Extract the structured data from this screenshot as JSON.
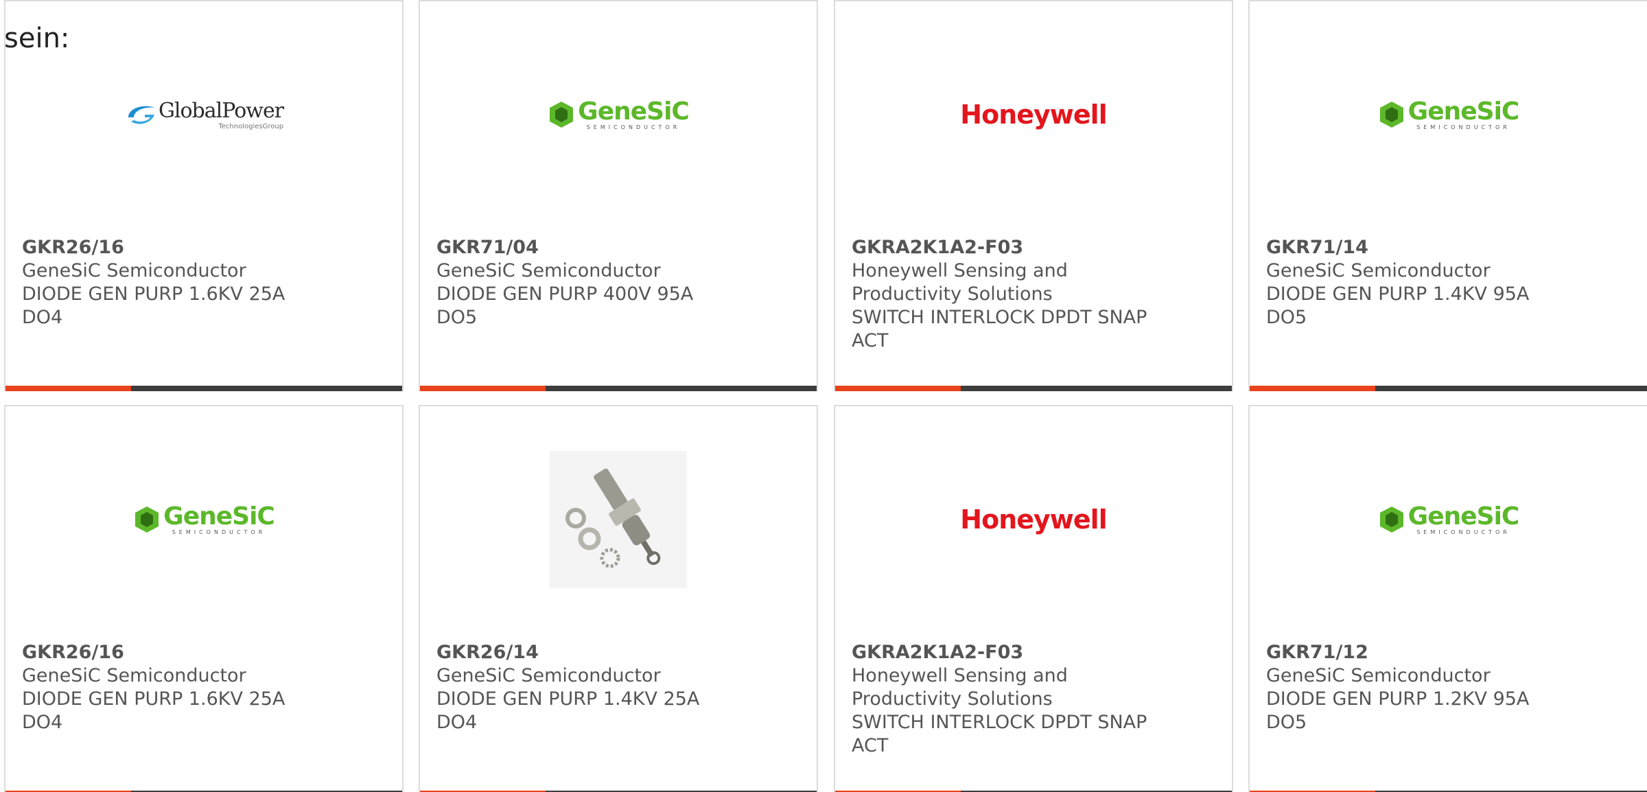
{
  "intro_text": "sein:",
  "colors": {
    "accent": "#e8431c",
    "bar": "#3d3d3d",
    "genesic_green": "#5cb82a",
    "honeywell_red": "#e3161d"
  },
  "products": [
    {
      "part": "GKR26/16",
      "manufacturer": "GeneSiC Semiconductor",
      "description": "DIODE GEN PURP 1.6KV 25A DO4",
      "logo": "globalpower-logo",
      "logo_text": "GlobalPower",
      "logo_sub": "TechnologiesGroup"
    },
    {
      "part": "GKR71/04",
      "manufacturer": "GeneSiC Semiconductor",
      "description": "DIODE GEN PURP 400V 95A DO5",
      "logo": "genesic-logo",
      "logo_text": "GeneSiC",
      "logo_sub": "SEMICONDUCTOR"
    },
    {
      "part": "GKRA2K1A2-F03",
      "manufacturer": "Honeywell Sensing and Productivity Solutions",
      "description": "SWITCH INTERLOCK DPDT SNAP ACT",
      "logo": "honeywell-logo",
      "logo_text": "Honeywell"
    },
    {
      "part": "GKR71/14",
      "manufacturer": "GeneSiC Semiconductor",
      "description": "DIODE GEN PURP 1.4KV 95A DO5",
      "logo": "genesic-logo",
      "logo_text": "GeneSiC",
      "logo_sub": "SEMICONDUCTOR"
    },
    {
      "part": "GKR26/16",
      "manufacturer": "GeneSiC Semiconductor",
      "description": "DIODE GEN PURP 1.6KV 25A DO4",
      "logo": "genesic-logo",
      "logo_text": "GeneSiC",
      "logo_sub": "SEMICONDUCTOR"
    },
    {
      "part": "GKR26/14",
      "manufacturer": "GeneSiC Semiconductor",
      "description": "DIODE GEN PURP 1.4KV 25A DO4",
      "logo": "stud-diode-photo"
    },
    {
      "part": "GKRA2K1A2-F03",
      "manufacturer": "Honeywell Sensing and Productivity Solutions",
      "description": "SWITCH INTERLOCK DPDT SNAP ACT",
      "logo": "honeywell-logo",
      "logo_text": "Honeywell"
    },
    {
      "part": "GKR71/12",
      "manufacturer": "GeneSiC Semiconductor",
      "description": "DIODE GEN PURP 1.2KV 95A DO5",
      "logo": "genesic-logo",
      "logo_text": "GeneSiC",
      "logo_sub": "SEMICONDUCTOR"
    }
  ]
}
